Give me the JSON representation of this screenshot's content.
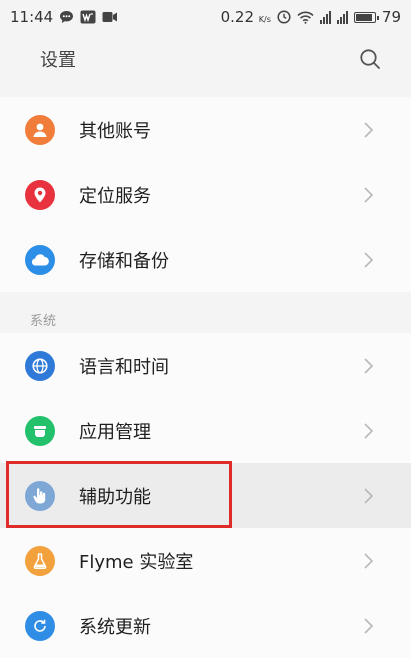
{
  "status_bar": {
    "time": "11:44",
    "speed": "0.22",
    "speed_unit": "K/s",
    "battery": "79",
    "battery_level": 0.79,
    "icons": [
      "chat-bubble-icon",
      "w-app-icon",
      "video-icon",
      "clock-icon",
      "wifi-icon",
      "signal-icon",
      "battery-icon"
    ]
  },
  "header": {
    "title": "设置",
    "search_icon": "search-icon"
  },
  "section_system": "系统",
  "items_top": [
    {
      "label": "其他账号",
      "icon": "person-icon",
      "color": "#f07d3a"
    },
    {
      "label": "定位服务",
      "icon": "location-pin-icon",
      "color": "#e8333e"
    },
    {
      "label": "存储和备份",
      "icon": "cloud-icon",
      "color": "#2c8ee6"
    }
  ],
  "items_system": [
    {
      "label": "语言和时间",
      "icon": "globe-icon",
      "color": "#2f79d8"
    },
    {
      "label": "应用管理",
      "icon": "app-manage-icon",
      "color": "#23c16b"
    },
    {
      "label": "辅助功能",
      "icon": "hand-icon",
      "color": "#7ea7d6",
      "highlighted": true
    },
    {
      "label": "Flyme 实验室",
      "icon": "flask-icon",
      "color": "#f2a13c"
    },
    {
      "label": "系统更新",
      "icon": "update-icon",
      "color": "#2f8de6"
    }
  ]
}
